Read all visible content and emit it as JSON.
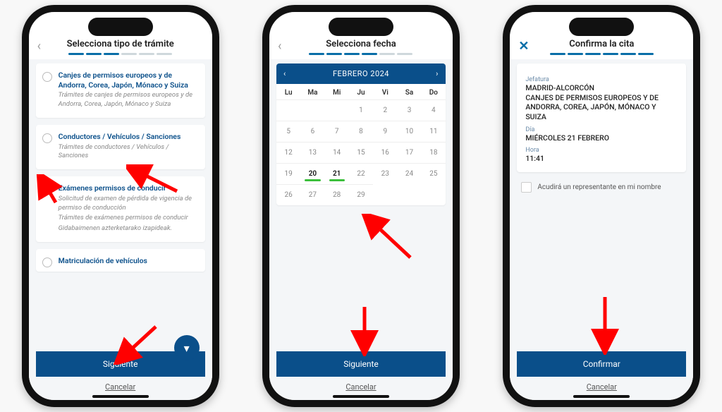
{
  "screen1": {
    "title": "Selecciona tipo de trámite",
    "options": [
      {
        "title": "Canjes de permisos europeos y de Andorra, Corea, Japón, Mónaco y Suiza",
        "desc": "Trámites de canjes de permisos europeos y de Andorra, Corea, Japón, Mónaco y Suiza"
      },
      {
        "title": "Conductores / Vehículos / Sanciones",
        "desc": "Trámites de conductores / Vehículos / Sanciones"
      },
      {
        "title": "Exámenes permisos de conducir",
        "desc1": "Solicitud de examen de pérdida de vigencia de permiso de conducción",
        "desc2": "Trámites de exámenes permisos de conducir",
        "desc3": "Gidabaimenen azterketarako izapideak."
      },
      {
        "title": "Matriculación de vehículos"
      }
    ],
    "next": "Siguiente",
    "cancel": "Cancelar"
  },
  "screen2": {
    "title": "Selecciona fecha",
    "month": "FEBRERO 2024",
    "dow": [
      "Lu",
      "Ma",
      "Mi",
      "Ju",
      "Vi",
      "Sa",
      "Do"
    ],
    "next": "Siguiente",
    "cancel": "Cancelar"
  },
  "screen3": {
    "title": "Confirma la cita",
    "l_jefatura": "Jefatura",
    "v_jefatura": "MADRID-ALCORCÓN",
    "v_tramite": "CANJES DE PERMISOS EUROPEOS Y DE ANDORRA, COREA, JAPÓN, MÓNACO Y SUIZA",
    "l_dia": "Día",
    "v_dia": "MIÉRCOLES 21 FEBRERO",
    "l_hora": "Hora",
    "v_hora": "11:41",
    "chk": "Acudirá un representante en mi nombre",
    "confirm": "Confirmar",
    "cancel": "Cancelar"
  }
}
